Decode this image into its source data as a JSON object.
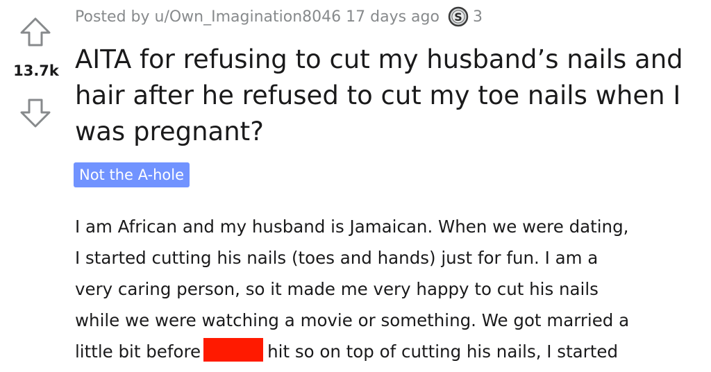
{
  "vote": {
    "score": "13.7k",
    "upvote_icon": "arrow-up-outline-icon",
    "downvote_icon": "arrow-down-outline-icon"
  },
  "meta": {
    "posted_by": "Posted by u/Own_Imagination8046 17 days ago",
    "award_icon": "silver-award-icon",
    "award_count": "3"
  },
  "post": {
    "title": "AITA for refusing to cut my husband’s nails and hair after he refused to cut my toe nails when I was pregnant?",
    "flair": "Not the A-hole",
    "flair_color": "#7193ff",
    "body_lines": [
      "I am African and my husband is Jamaican. When we were dating,",
      "I started cutting his nails (toes and hands) just for fun. I am a",
      "very caring person, so it made me very happy to cut his nails",
      "while we were watching a movie or something. We got married a"
    ],
    "last_line_before": "little bit before",
    "last_line_after": "hit so on top of cutting his nails, I started",
    "redaction_color": "#ff1a00"
  }
}
